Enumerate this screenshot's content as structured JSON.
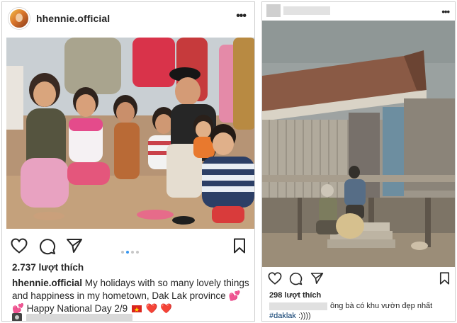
{
  "left_post": {
    "username": "hhennie.official",
    "more_icon": "more-horizontal-icon",
    "likes": "2.737 lượt thích",
    "caption_user": "hhennie.official",
    "caption_text_1": "My holidays with so many lovely things and happiness in my hometown, Dak Lak province",
    "caption_emoji_hearts": "💕💕",
    "caption_text_2": "Happy National Day 2/9",
    "caption_hearts_end": "❤️ ❤️",
    "carousel": {
      "total": 4,
      "active": 2
    },
    "icons": [
      "heart-icon",
      "comment-icon",
      "share-icon",
      "bookmark-icon"
    ]
  },
  "right_post": {
    "more_icon": "more-horizontal-icon",
    "likes": "298 lượt thích",
    "caption_text": "ông bà có khu vườn đẹp nhất",
    "hashtag": "#daklak",
    "hashtag_suffix": " :))))",
    "icons": [
      "heart-icon",
      "comment-icon",
      "share-icon",
      "bookmark-icon"
    ]
  },
  "colors": {
    "text": "#262626",
    "carousel_active": "#3897f0",
    "carousel_inactive": "#c7c7c7",
    "border": "#d0d0d0",
    "hashtag": "#003569"
  }
}
